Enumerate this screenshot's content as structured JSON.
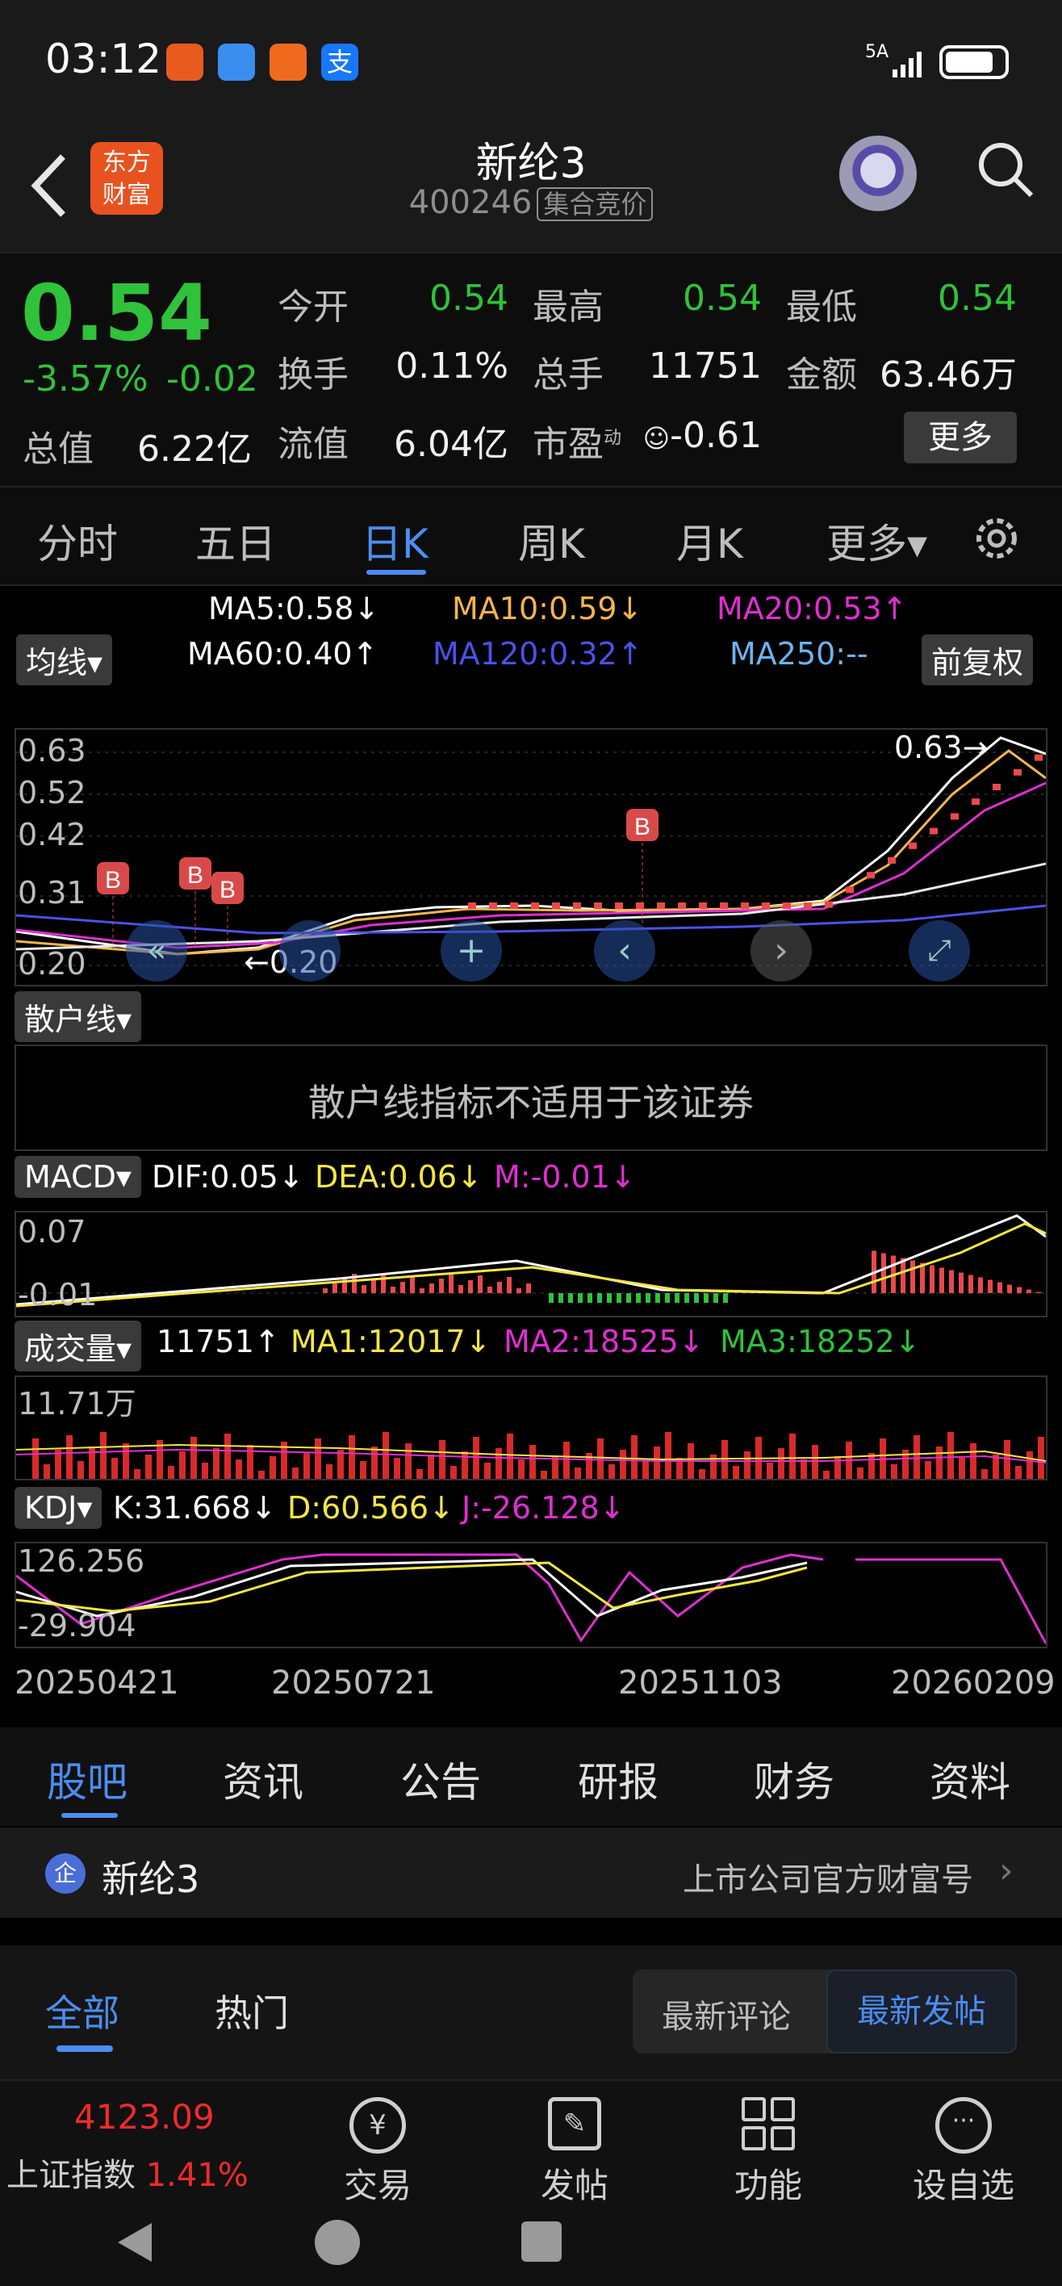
{
  "status_bar": {
    "time": "03:12",
    "signal": "5A"
  },
  "header": {
    "name": "新纶3",
    "code": "400246",
    "tag": "集合竞价",
    "logo_line1": "东方",
    "logo_line2": "财富"
  },
  "quote": {
    "price": "0.54",
    "change_pct": "-3.57%",
    "change": "-0.02",
    "open_label": "今开",
    "open": "0.54",
    "high_label": "最高",
    "high": "0.54",
    "low_label": "最低",
    "low": "0.54",
    "turnover_label": "换手",
    "turnover": "0.11%",
    "volume_label": "总手",
    "volume": "11751",
    "amount_label": "金额",
    "amount": "63.46万",
    "mcap_label": "总值",
    "mcap": "6.22亿",
    "float_label": "流值",
    "float": "6.04亿",
    "pe_label": "市盈",
    "pe_sup": "动",
    "pe": "-0.61",
    "more": "更多"
  },
  "period_tabs": [
    "分时",
    "五日",
    "日K",
    "周K",
    "月K",
    "更多▾"
  ],
  "ma": {
    "ma5": "MA5:0.58↓",
    "ma10": "MA10:0.59↓",
    "ma20": "MA20:0.53↑",
    "ma60": "MA60:0.40↑",
    "ma120": "MA120:0.32↑",
    "ma250": "MA250:--",
    "ma_select": "均线▾",
    "adjust": "前复权",
    "colors": {
      "ma5": "#ffffff",
      "ma10": "#f5b64a",
      "ma20": "#e02ed2",
      "ma60": "#ffffff",
      "ma120": "#4a52e8",
      "ma250": "#6cb4ee"
    }
  },
  "kline": {
    "y_ticks": [
      "0.63",
      "0.52",
      "0.42",
      "0.31",
      "0.20"
    ],
    "max_marker": "0.63→",
    "min_marker": "←0.20",
    "b_label": "B"
  },
  "retail": {
    "select": "散户线▾",
    "notice": "散户线指标不适用于该证券"
  },
  "macd": {
    "select": "MACD▾",
    "dif": "DIF:0.05↓",
    "dea": "DEA:0.06↓",
    "m": "M:-0.01↓",
    "y_top": "0.07",
    "y_bot": "-0.01"
  },
  "volume": {
    "select": "成交量▾",
    "vol": "11751↑",
    "ma1": "MA1:12017↓",
    "ma2": "MA2:18525↓",
    "ma3": "MA3:18252↓",
    "y_top": "11.71万"
  },
  "kdj": {
    "select": "KDJ▾",
    "k": "K:31.668↓",
    "d": "D:60.566↓",
    "j": "J:-26.128↓",
    "y_top": "126.256",
    "y_bot": "-29.904"
  },
  "dates": [
    "20250421",
    "20250721",
    "20251103",
    "20260209"
  ],
  "content_tabs": [
    "股吧",
    "资讯",
    "公告",
    "研报",
    "财务",
    "资料"
  ],
  "company": {
    "badge": "企",
    "name": "新纶3",
    "link": "上市公司官方财富号"
  },
  "filters": {
    "all": "全部",
    "hot": "热门",
    "latest_comment": "最新评论",
    "latest_post": "最新发帖"
  },
  "bottom": {
    "index_value": "4123.09",
    "index_name": "上证指数",
    "index_pct": "1.41%",
    "nav": [
      "交易",
      "发帖",
      "功能",
      "设自选"
    ]
  }
}
